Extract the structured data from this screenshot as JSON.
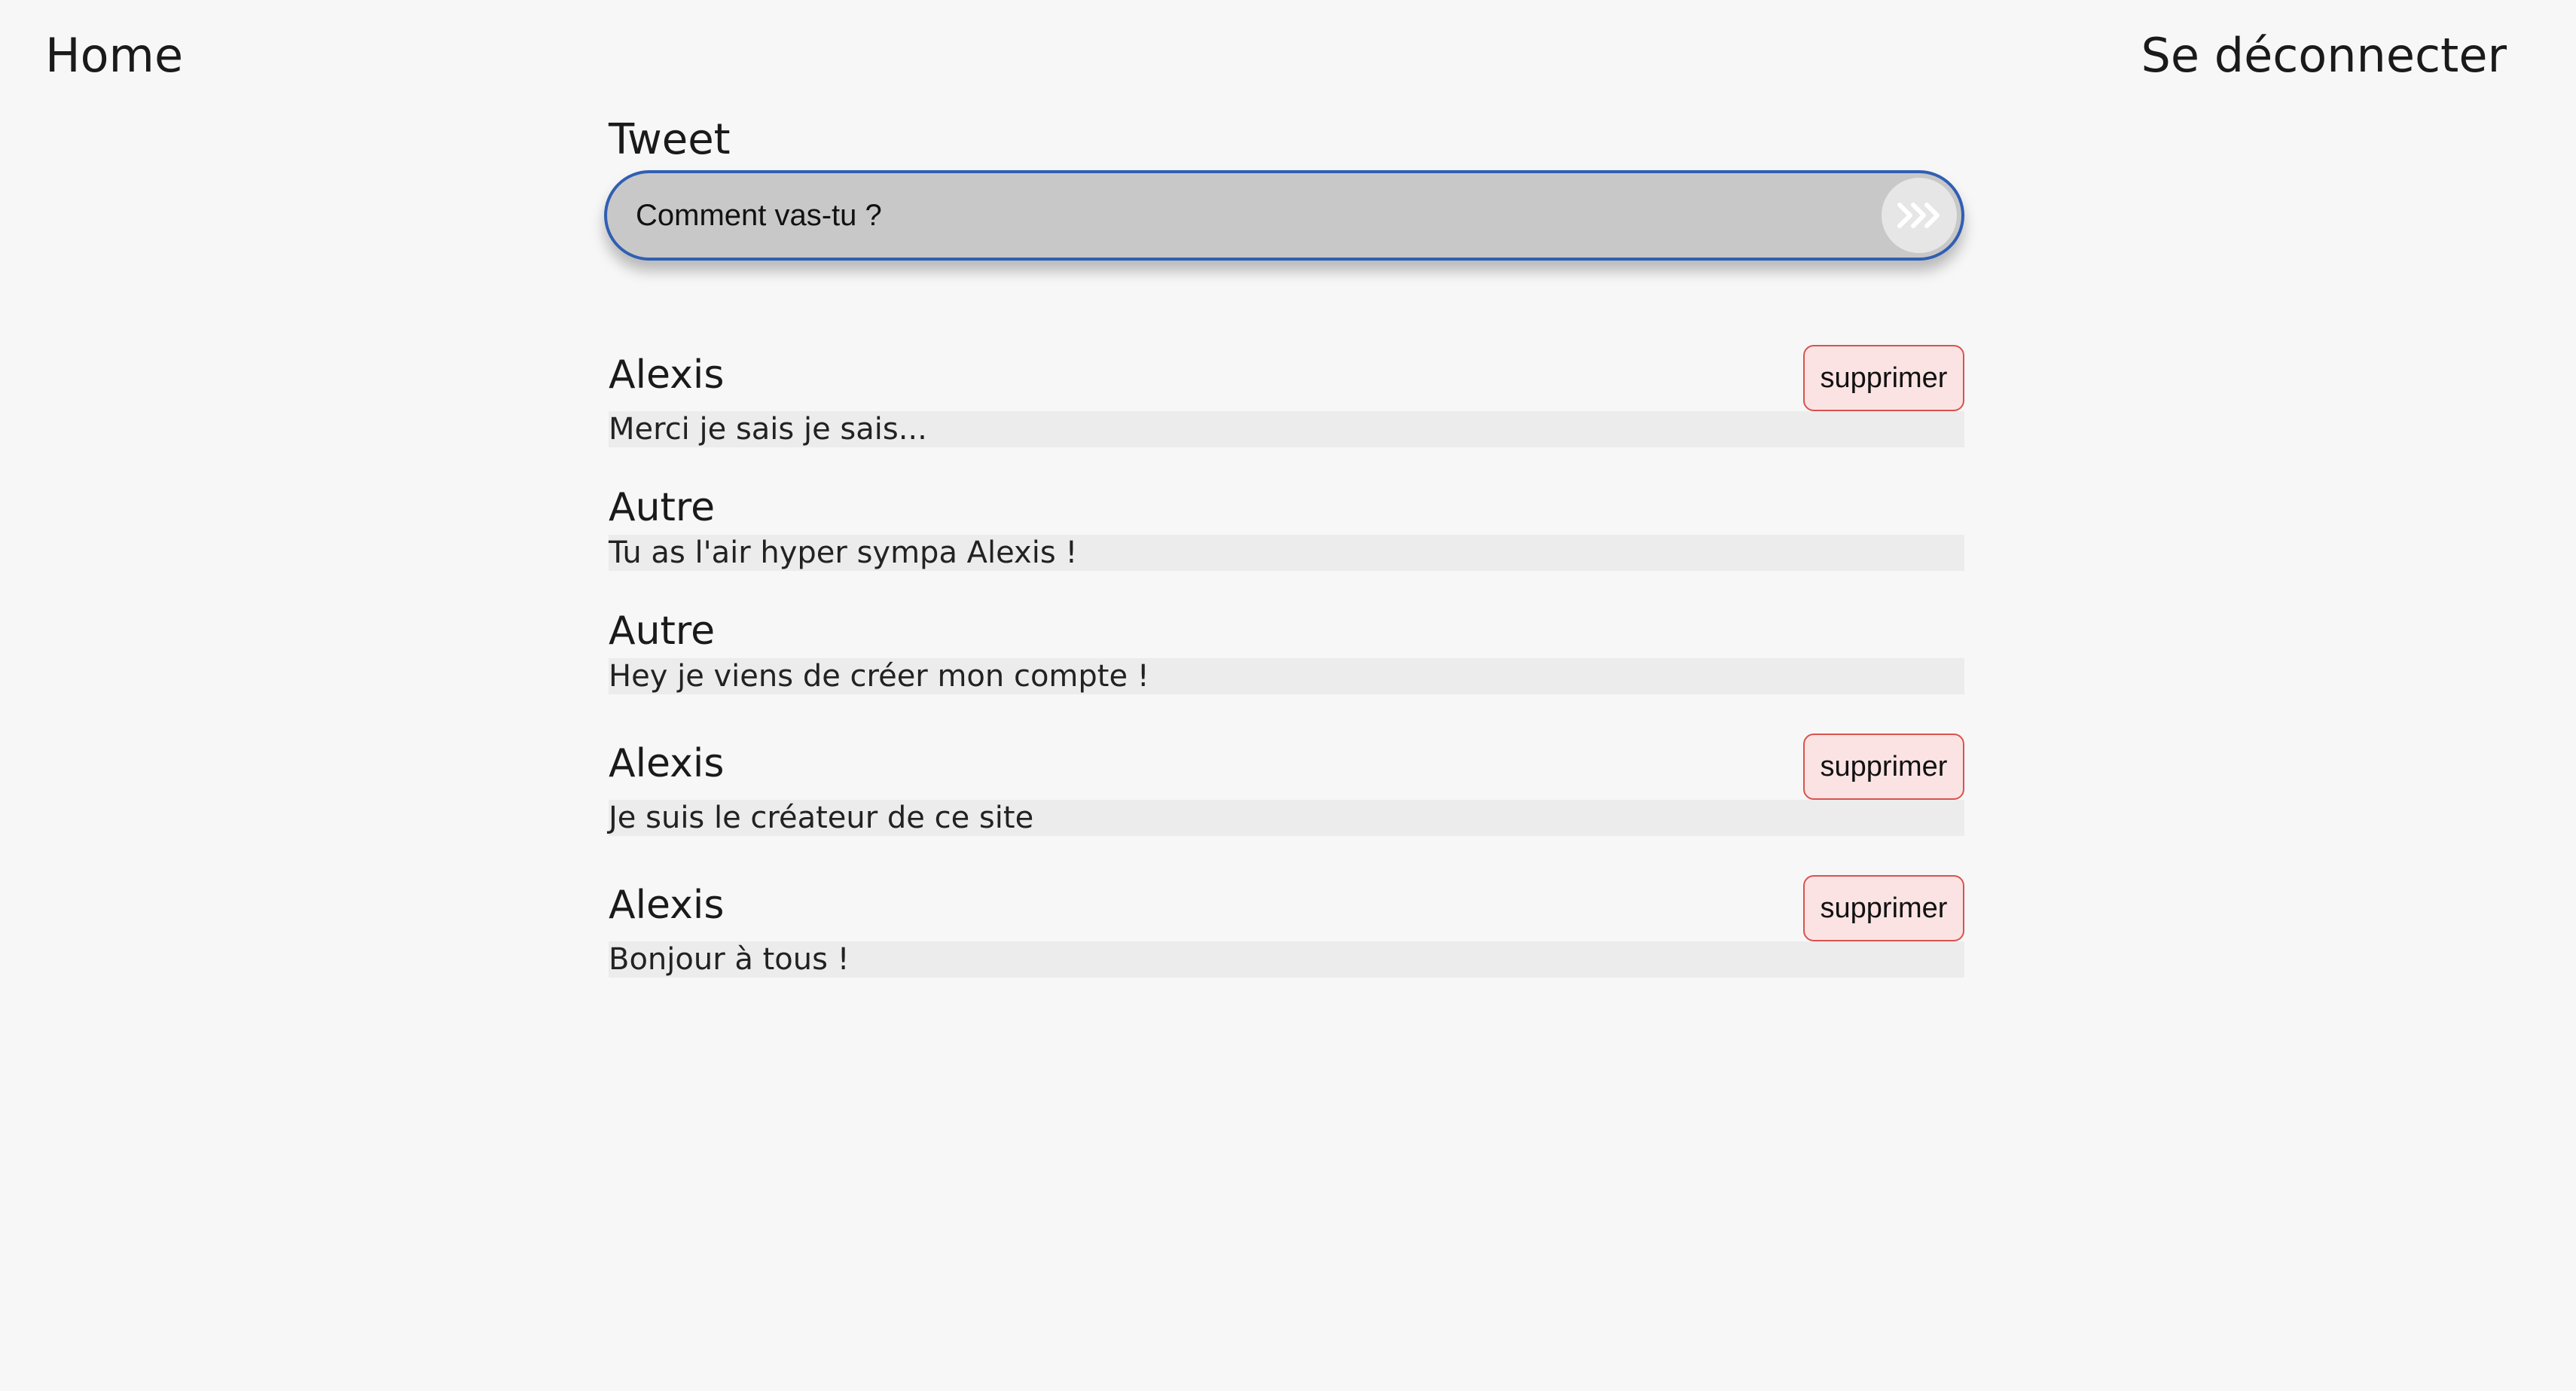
{
  "nav": {
    "home_label": "Home",
    "logout_label": "Se déconnecter"
  },
  "composer": {
    "label": "Tweet",
    "input_value": "Comment vas-tu ?",
    "send_icon": "send-arrows-icon"
  },
  "feed": {
    "delete_label": "supprimer",
    "posts": [
      {
        "author": "Alexis",
        "message": "Merci je sais je sais...",
        "deletable": true
      },
      {
        "author": "Autre",
        "message": "Tu as l'air hyper sympa Alexis !",
        "deletable": false
      },
      {
        "author": "Autre",
        "message": "Hey je viens de créer mon compte !",
        "deletable": false
      },
      {
        "author": "Alexis",
        "message": "Je suis le créateur de ce site",
        "deletable": true
      },
      {
        "author": "Alexis",
        "message": "Bonjour à tous !",
        "deletable": true
      }
    ]
  },
  "colors": {
    "background": "#f7f7f7",
    "input_border": "#2f5fb3",
    "input_fill": "#c8c8c8",
    "delete_border": "#d9534f",
    "delete_fill": "#fbe3e3",
    "message_fill": "#ececec"
  }
}
